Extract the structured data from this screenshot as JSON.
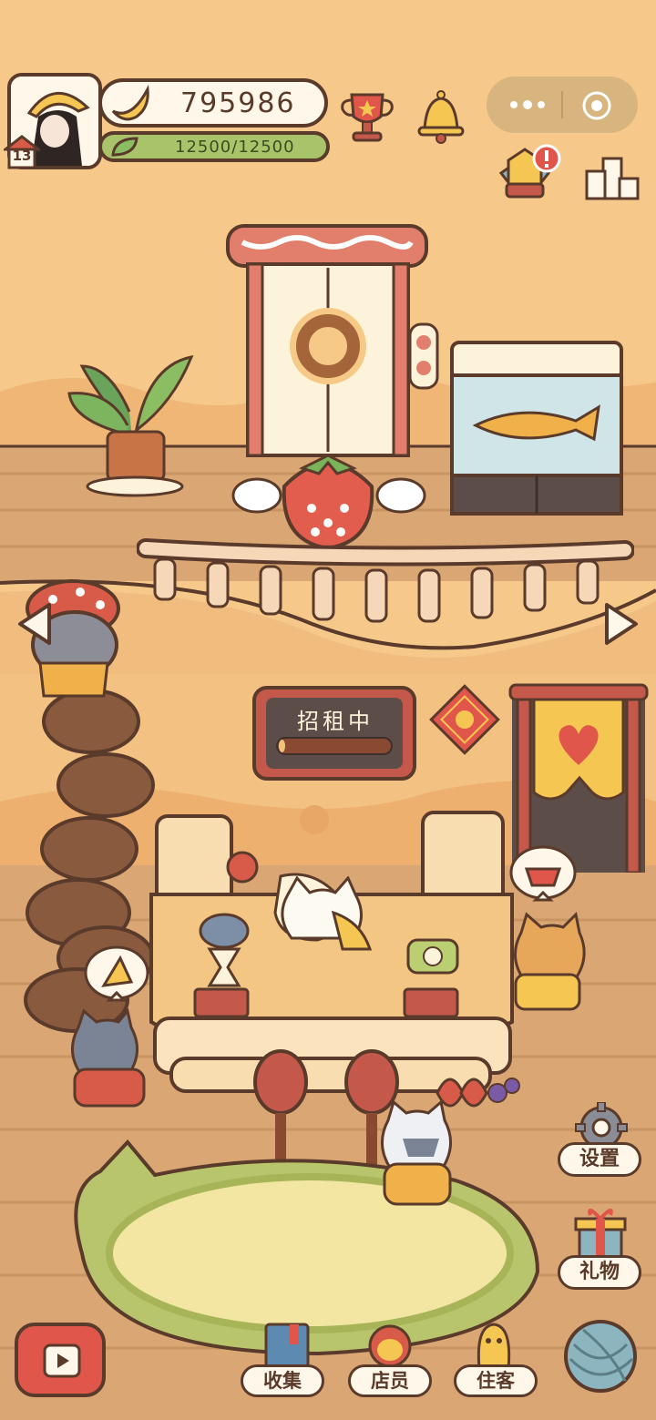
{
  "player": {
    "level": "13",
    "bananas": "795986",
    "energy": "12500/12500",
    "energy_fraction": 1.0
  },
  "hud_icons": [
    "trophy-icon",
    "bell-icon",
    "more-icon",
    "target-icon",
    "badge-icon",
    "leaderboard-icon"
  ],
  "room": {
    "sign_text": "招租中",
    "sign_progress_fraction": 0.05
  },
  "side_menu": {
    "settings_label": "设置",
    "gift_label": "礼物"
  },
  "dock": {
    "collect_label": "收集",
    "staff_label": "店员",
    "guests_label": "住客"
  },
  "colors": {
    "background": "#f6c98a",
    "outline": "#5a3a2a",
    "floor": "#d9a674",
    "rug": "#b8c56d",
    "accent_red": "#e0564a"
  }
}
